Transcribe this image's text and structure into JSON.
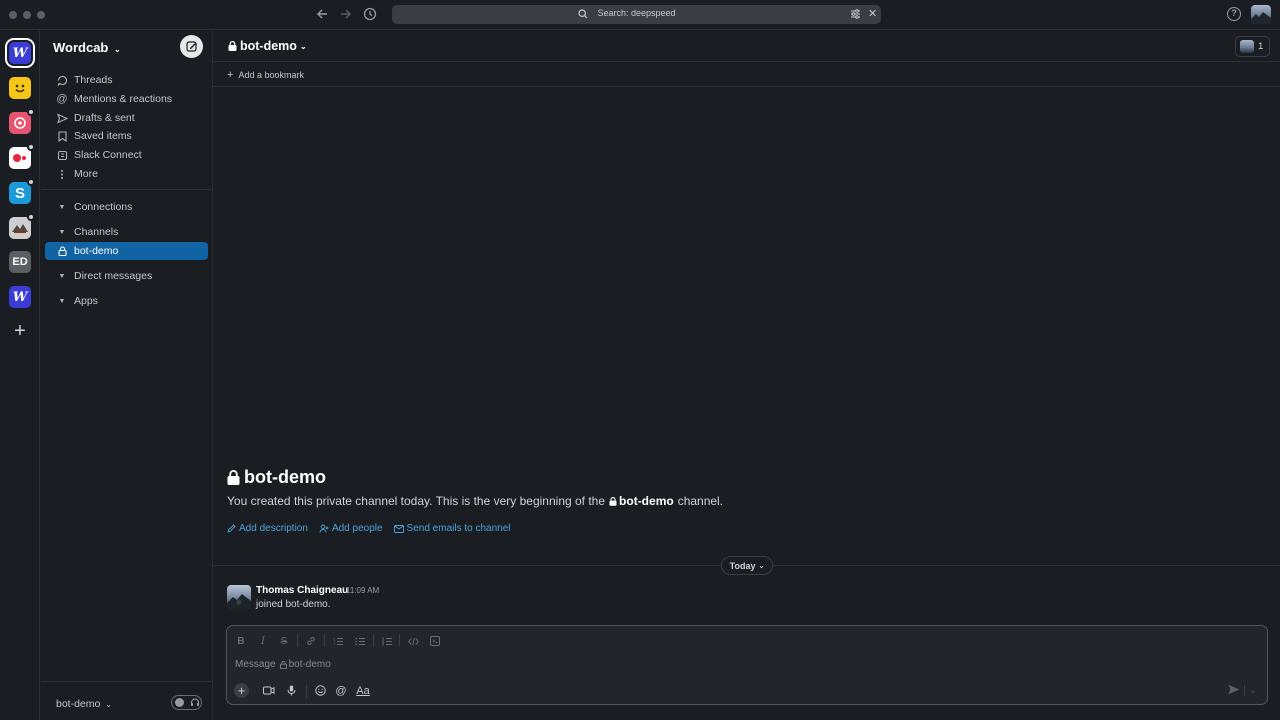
{
  "titlebar": {
    "search_label": "Search: deepspeed"
  },
  "rail": {
    "workspaces": [
      {
        "name": "workspace-wordcab",
        "letter": "W",
        "color": "#3b3bd8",
        "active": true
      },
      {
        "name": "workspace-yellow",
        "letter": "",
        "color": "#f5c518",
        "active": false
      },
      {
        "name": "workspace-pink",
        "letter": "",
        "color": "#e8536f",
        "active": false
      },
      {
        "name": "workspace-red",
        "letter": "",
        "color": "#ffffff",
        "active": false
      },
      {
        "name": "workspace-blue-s",
        "letter": "S",
        "color": "#1a9bd7",
        "active": false
      },
      {
        "name": "workspace-photo",
        "letter": "",
        "color": "#cfcfcf",
        "active": false
      },
      {
        "name": "workspace-ed",
        "letter": "ED",
        "color": "#5b5e63",
        "active": false
      },
      {
        "name": "workspace-wordcab-2",
        "letter": "W",
        "color": "#3b3bd8",
        "active": false
      }
    ]
  },
  "sidebar": {
    "workspace_name": "Wordcab",
    "items": [
      {
        "label": "Threads"
      },
      {
        "label": "Mentions & reactions"
      },
      {
        "label": "Drafts & sent"
      },
      {
        "label": "Saved items"
      },
      {
        "label": "Slack Connect"
      },
      {
        "label": "More"
      }
    ],
    "sections": {
      "connections": "Connections",
      "channels": "Channels",
      "channel_item": "bot-demo",
      "direct_messages": "Direct messages",
      "apps": "Apps"
    },
    "footer_label": "bot-demo"
  },
  "header": {
    "channel_name": "bot-demo",
    "member_count": "1",
    "bookmark_label": "Add a bookmark"
  },
  "intro": {
    "title": "bot-demo",
    "desc_before": "You created this private channel today. This is the very beginning of the",
    "desc_channel": "bot-demo",
    "desc_after": "channel.",
    "links": {
      "add_description": "Add description",
      "add_people": "Add people",
      "send_emails": "Send emails to channel"
    }
  },
  "divider": {
    "date_label": "Today"
  },
  "message": {
    "author": "Thomas Chaigneau",
    "time": "11:09 AM",
    "text": "joined bot-demo."
  },
  "composer": {
    "placeholder_prefix": "Message",
    "placeholder_channel": "bot-demo",
    "format_label": "Aa"
  }
}
